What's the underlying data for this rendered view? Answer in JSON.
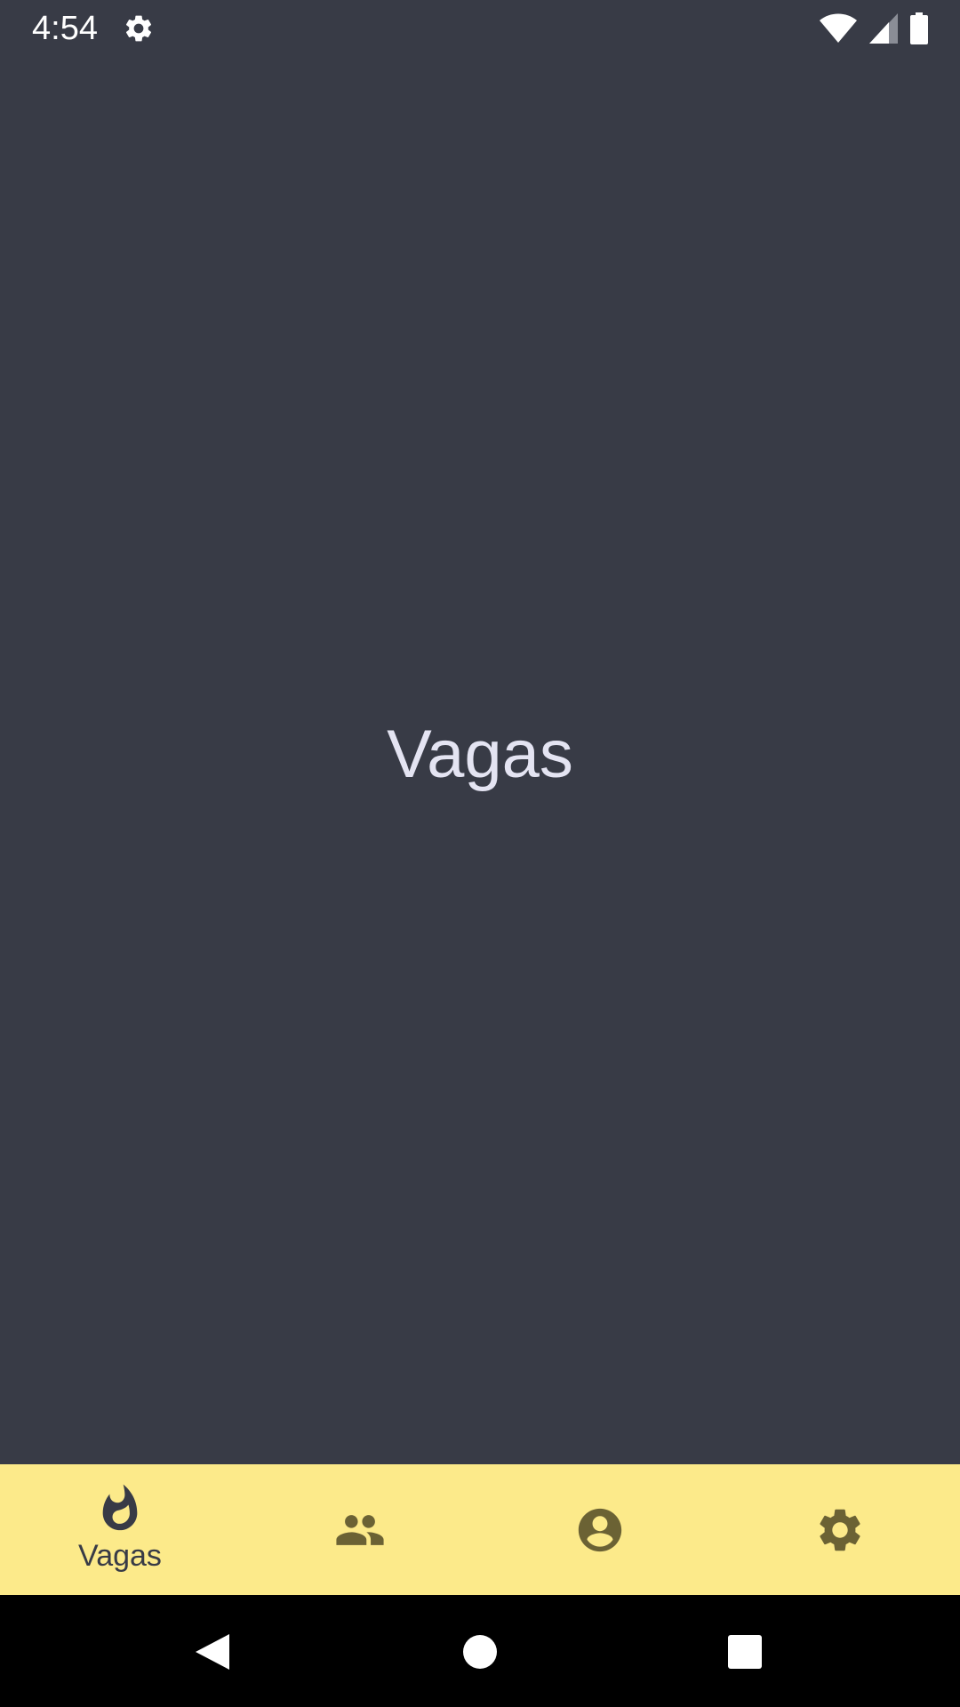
{
  "status_bar": {
    "time": "4:54",
    "icons": [
      "gear-icon",
      "wifi-icon",
      "signal-icon",
      "battery-icon"
    ]
  },
  "main": {
    "title": "Vagas"
  },
  "bottom_nav": {
    "items": [
      {
        "icon": "flame-icon",
        "label": "Vagas",
        "active": true
      },
      {
        "icon": "people-icon",
        "label": "",
        "active": false
      },
      {
        "icon": "account-circle-icon",
        "label": "",
        "active": false
      },
      {
        "icon": "settings-icon",
        "label": "",
        "active": false
      }
    ]
  },
  "system_nav": {
    "buttons": [
      "back-icon",
      "home-icon",
      "recents-icon"
    ]
  },
  "colors": {
    "background": "#383b46",
    "nav_background": "#fcea8a",
    "nav_active": "#383b46",
    "nav_inactive": "#6b6234",
    "title_text": "#e4e4f2"
  }
}
